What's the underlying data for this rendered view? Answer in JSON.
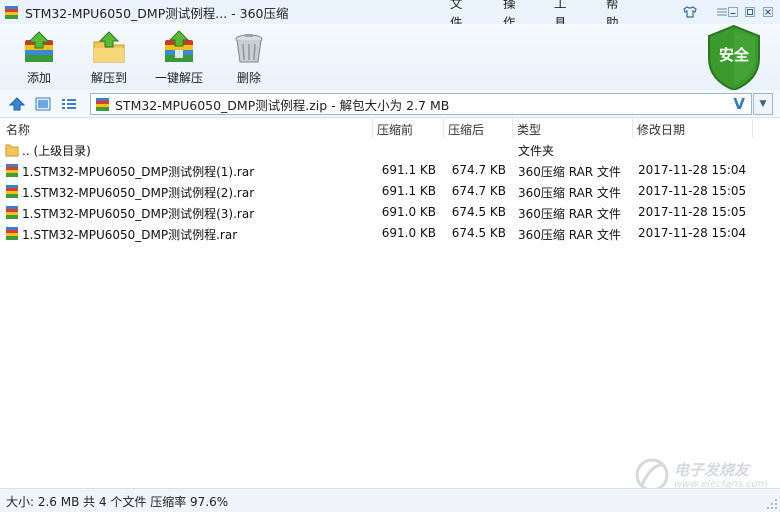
{
  "window": {
    "title": "STM32-MPU6050_DMP测试例程... - 360压缩",
    "menus": [
      "文件",
      "操作",
      "工具",
      "帮助"
    ]
  },
  "toolbar": {
    "add_label": "添加",
    "extract_to_label": "解压到",
    "one_click_label": "一键解压",
    "delete_label": "删除"
  },
  "security": {
    "label": "安全",
    "color": "#3b9a2e"
  },
  "nav": {
    "path": "STM32-MPU6050_DMP测试例程.zip - 解包大小为 2.7 MB",
    "dropdown_glyph": "V"
  },
  "columns": {
    "name": "名称",
    "packed": "压缩前",
    "unpacked": "压缩后",
    "type": "类型",
    "modified": "修改日期"
  },
  "files": [
    {
      "name": ".. (上级目录)",
      "packed": "",
      "unpacked": "",
      "type": "文件夹",
      "modified": "",
      "icon": "folder-icon"
    },
    {
      "name": "1.STM32-MPU6050_DMP测试例程(1).rar",
      "packed": "691.1 KB",
      "unpacked": "674.7 KB",
      "type": "360压缩 RAR 文件",
      "modified": "2017-11-28 15:04",
      "icon": "rar-file-icon"
    },
    {
      "name": "1.STM32-MPU6050_DMP测试例程(2).rar",
      "packed": "691.1 KB",
      "unpacked": "674.7 KB",
      "type": "360压缩 RAR 文件",
      "modified": "2017-11-28 15:05",
      "icon": "rar-file-icon"
    },
    {
      "name": "1.STM32-MPU6050_DMP测试例程(3).rar",
      "packed": "691.0 KB",
      "unpacked": "674.5 KB",
      "type": "360压缩 RAR 文件",
      "modified": "2017-11-28 15:05",
      "icon": "rar-file-icon"
    },
    {
      "name": "1.STM32-MPU6050_DMP测试例程.rar",
      "packed": "691.0 KB",
      "unpacked": "674.5 KB",
      "type": "360压缩 RAR 文件",
      "modified": "2017-11-28 15:04",
      "icon": "rar-file-icon"
    }
  ],
  "status": {
    "text": "大小: 2.6 MB 共 4 个文件 压缩率 97.6%"
  },
  "watermark": {
    "brand": "电子发烧友",
    "url": "www.elecfans.com"
  }
}
